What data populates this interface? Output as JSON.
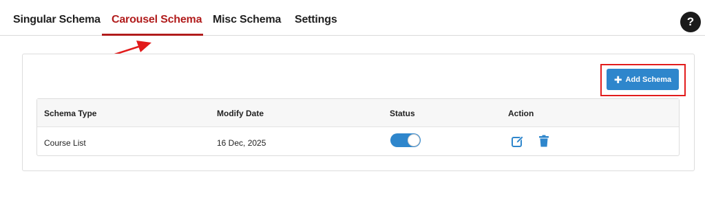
{
  "tabs": [
    {
      "label": "Singular Schema"
    },
    {
      "label": "Carousel Schema"
    },
    {
      "label": "Misc Schema"
    },
    {
      "label": "Settings"
    }
  ],
  "active_tab": "Carousel Schema",
  "help": {
    "label": "?"
  },
  "toolbar": {
    "add_label": "Add Schema",
    "add_icon": "plus-icon"
  },
  "table": {
    "headers": [
      "Schema Type",
      "Modify Date",
      "Status",
      "Action"
    ],
    "rows": [
      {
        "schema_type": "Course List",
        "modify_date": "16 Dec, 2025",
        "status_enabled": true,
        "actions": [
          "edit-icon",
          "trash-icon"
        ]
      }
    ]
  },
  "colors": {
    "accent": "#2e86cc",
    "active_tab": "#b11c1c",
    "highlight": "#e21b1b",
    "help_bg": "#1b1b1b"
  }
}
